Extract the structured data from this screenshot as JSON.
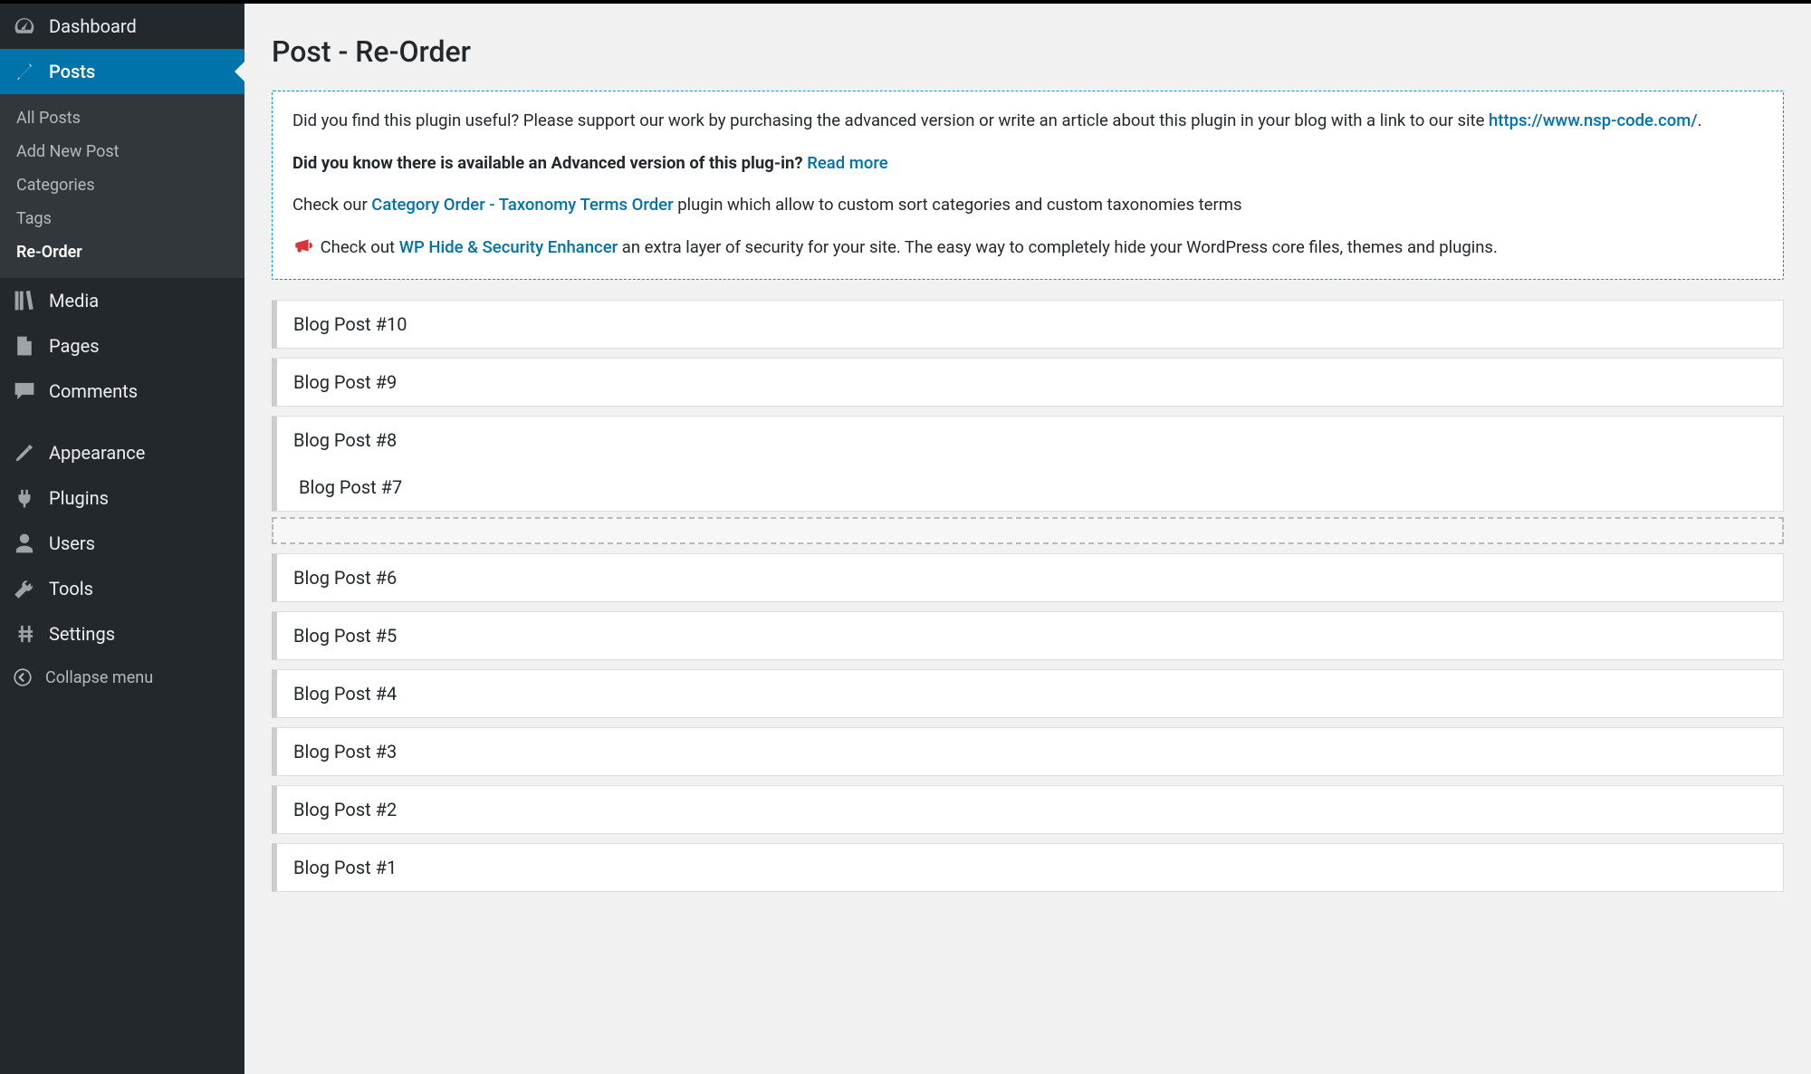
{
  "page": {
    "title": "Post - Re-Order"
  },
  "sidebar": {
    "dashboard": "Dashboard",
    "posts": "Posts",
    "posts_sub": {
      "all": "All Posts",
      "add": "Add New Post",
      "categories": "Categories",
      "tags": "Tags",
      "reorder": "Re-Order"
    },
    "media": "Media",
    "pages": "Pages",
    "comments": "Comments",
    "appearance": "Appearance",
    "plugins": "Plugins",
    "users": "Users",
    "tools": "Tools",
    "settings": "Settings",
    "collapse": "Collapse menu"
  },
  "notice": {
    "p1a": "Did you find this plugin useful? Please support our work by purchasing the advanced version or write an article about this plugin in your blog with a link to our site ",
    "p1_link": "https://www.nsp-code.com/",
    "p1b": ".",
    "p2_strong": "Did you know there is available an Advanced version of this plug-in?",
    "p2_link": "Read more",
    "p3a": "Check our ",
    "p3_link": "Category Order - Taxonomy Terms Order",
    "p3b": " plugin which allow to custom sort categories and custom taxonomies terms",
    "p4a": "Check out ",
    "p4_link": "WP Hide & Security Enhancer",
    "p4b": " an extra layer of security for your site. The easy way to completely hide your WordPress core files, themes and plugins."
  },
  "list": {
    "items": [
      "Blog Post #10",
      "Blog Post #9",
      "Blog Post #8",
      "Blog Post #7",
      "Blog Post #6",
      "Blog Post #5",
      "Blog Post #4",
      "Blog Post #3",
      "Blog Post #2",
      "Blog Post #1"
    ]
  }
}
